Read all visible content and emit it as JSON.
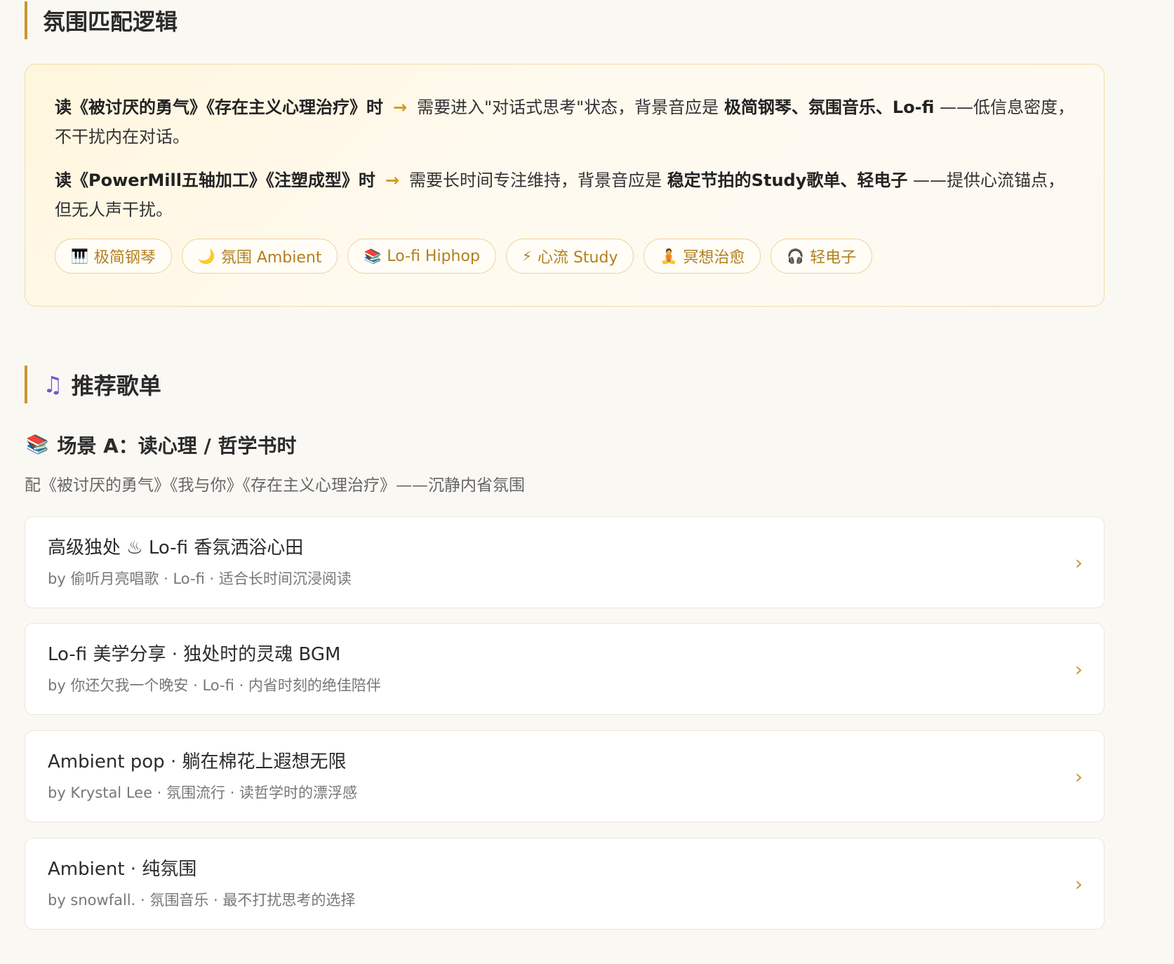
{
  "section1": {
    "title": "氛围匹配逻辑"
  },
  "logic": {
    "para1": {
      "lead": "读《被讨厌的勇气》《存在主义心理治疗》时",
      "arrow": "→",
      "mid": "需要进入\"对话式思考\"状态，背景音应是",
      "bold": "极简钢琴、氛围音乐、Lo-fi",
      "tail": "——低信息密度，不干扰内在对话。"
    },
    "para2": {
      "lead": "读《PowerMill五轴加工》《注塑成型》时",
      "arrow": "→",
      "mid": "需要长时间专注维持，背景音应是",
      "bold": "稳定节拍的Study歌单、轻电子",
      "tail": "——提供心流锚点，但无人声干扰。"
    },
    "tags": [
      {
        "icon": "🎹",
        "icon_name": "piano-icon",
        "label": "极简钢琴"
      },
      {
        "icon": "🌙",
        "icon_name": "moon-icon",
        "label": "氛围 Ambient"
      },
      {
        "icon": "📚",
        "icon_name": "books-icon",
        "label": "Lo-fi Hiphop"
      },
      {
        "icon": "⚡",
        "icon_name": "lightning-icon",
        "label": "心流 Study"
      },
      {
        "icon": "🧘",
        "icon_name": "meditation-icon",
        "label": "冥想治愈"
      },
      {
        "icon": "🎧",
        "icon_name": "headphones-icon",
        "label": "轻电子"
      }
    ]
  },
  "section2": {
    "icon": "♫",
    "title": "推荐歌单"
  },
  "scene": {
    "icon": "📚",
    "title": "场景 A：读心理 / 哲学书时",
    "desc": "配《被讨厌的勇气》《我与你》《存在主义心理治疗》——沉静内省氛围"
  },
  "playlists": [
    {
      "title": "高级独处 ♨ Lo-fi 香氛洒浴心田",
      "sub": "by 偷听月亮唱歌 · Lo-fi · 适合长时间沉浸阅读",
      "chevron": "›"
    },
    {
      "title": "Lo-fi 美学分享 · 独处时的灵魂 BGM",
      "sub": "by 你还欠我一个晚安 · Lo-fi · 内省时刻的绝佳陪伴",
      "chevron": "›"
    },
    {
      "title": "Ambient pop · 躺在棉花上遐想无限",
      "sub": "by Krystal Lee · 氛围流行 · 读哲学时的漂浮感",
      "chevron": "›"
    },
    {
      "title": "Ambient · 纯氛围",
      "sub": "by snowfall. · 氛围音乐 · 最不打扰思考的选择",
      "chevron": "›"
    }
  ],
  "colors": {
    "accent": "#c9962e",
    "tag_text": "#b27f1e",
    "page_bg": "#faf8f3"
  }
}
